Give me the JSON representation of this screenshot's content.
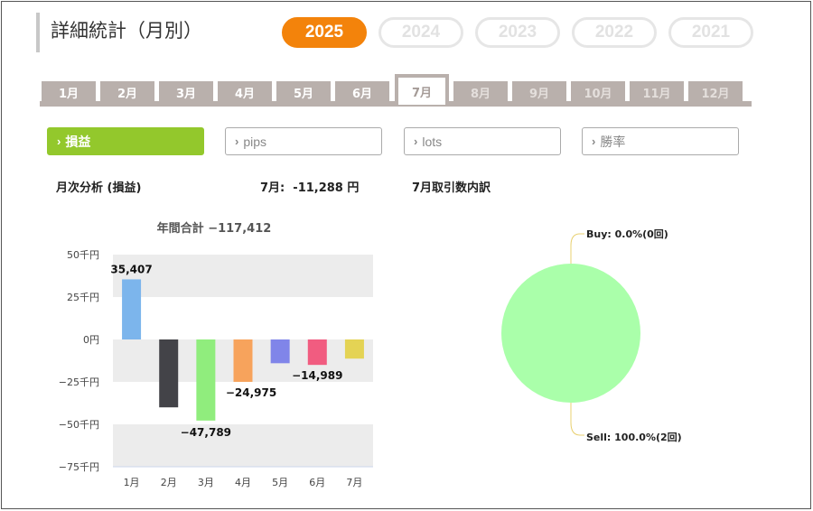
{
  "header": {
    "title": "詳細統計（月別）",
    "years": [
      {
        "label": "2025",
        "active": true
      },
      {
        "label": "2024",
        "active": false
      },
      {
        "label": "2023",
        "active": false
      },
      {
        "label": "2022",
        "active": false
      },
      {
        "label": "2021",
        "active": false
      }
    ]
  },
  "month_tabs": [
    {
      "label": "1月",
      "state": "past"
    },
    {
      "label": "2月",
      "state": "past"
    },
    {
      "label": "3月",
      "state": "past"
    },
    {
      "label": "4月",
      "state": "past"
    },
    {
      "label": "5月",
      "state": "past"
    },
    {
      "label": "6月",
      "state": "past"
    },
    {
      "label": "7月",
      "state": "active"
    },
    {
      "label": "8月",
      "state": "future"
    },
    {
      "label": "9月",
      "state": "future"
    },
    {
      "label": "10月",
      "state": "future"
    },
    {
      "label": "11月",
      "state": "future"
    },
    {
      "label": "12月",
      "state": "future"
    }
  ],
  "metrics": [
    {
      "label": "損益",
      "active": true
    },
    {
      "label": "pips",
      "active": false
    },
    {
      "label": "lots",
      "active": false
    },
    {
      "label": "勝率",
      "active": false
    }
  ],
  "analysis": {
    "heading": "月次分析 (損益)",
    "month_summary": "7月:  -11,288 円",
    "breakdown_heading": "7月取引数内訳"
  },
  "colors": {
    "accent_orange": "#f3830b",
    "accent_green": "#93c82c",
    "tab_gray": "#b9b0ac",
    "pie_sell": "#aaffaa",
    "pie_leader": "#e8d070"
  },
  "chart_data": [
    {
      "type": "bar",
      "title": "年間合計 −117,412",
      "categories": [
        "1月",
        "2月",
        "3月",
        "4月",
        "5月",
        "6月",
        "7月"
      ],
      "values": [
        35407,
        -40000,
        -47789,
        -24975,
        -14000,
        -14989,
        -11288
      ],
      "data_labels": [
        {
          "index": 0,
          "text": "35,407"
        },
        {
          "index": 2,
          "text": "−47,789"
        },
        {
          "index": 3,
          "text": "−24,975"
        },
        {
          "index": 5,
          "text": "−14,989"
        }
      ],
      "bar_colors": [
        "#7cb5ec",
        "#434348",
        "#90ed7d",
        "#f7a35c",
        "#8085e9",
        "#f15c80",
        "#e4d354"
      ],
      "yticks": [
        {
          "value": 50000,
          "label": "50千円"
        },
        {
          "value": 25000,
          "label": "25千円"
        },
        {
          "value": 0,
          "label": "0円"
        },
        {
          "value": -25000,
          "label": "−25千円"
        },
        {
          "value": -50000,
          "label": "−50千円"
        },
        {
          "value": -75000,
          "label": "−75千円"
        }
      ],
      "ylim": [
        -75000,
        50000
      ],
      "grid": "alternating bands"
    },
    {
      "type": "pie",
      "slices": [
        {
          "name": "Buy",
          "label": "Buy: 0.0%(0回)",
          "value": 0,
          "color": "#aaffaa"
        },
        {
          "name": "Sell",
          "label": "Sell: 100.0%(2回)",
          "value": 100,
          "color": "#aaffaa"
        }
      ]
    }
  ]
}
